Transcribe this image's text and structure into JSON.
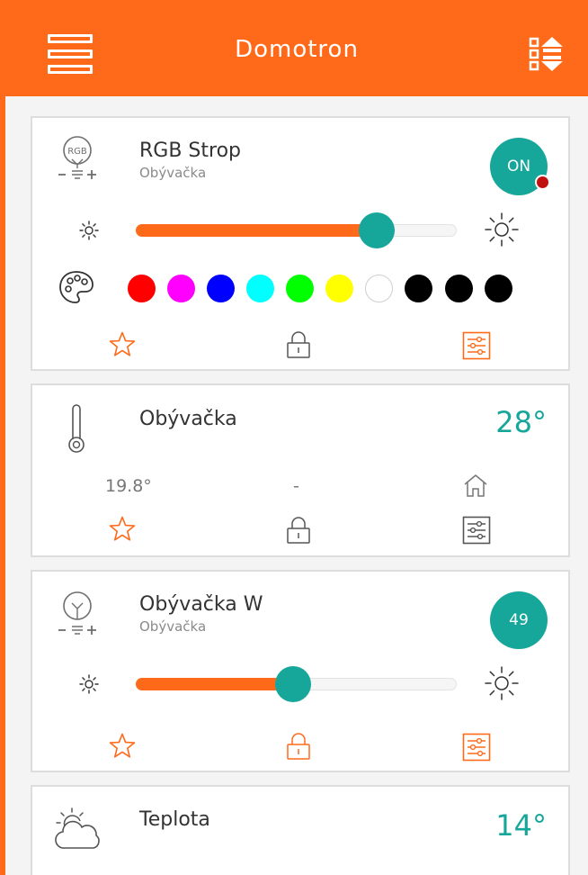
{
  "header": {
    "title": "Domotron",
    "menu_icon": "menu-icon",
    "sort_icon": "sort-icon"
  },
  "colors": {
    "accent": "#ff6a1a",
    "teal": "#17a79a",
    "badge_dot": "#c01010"
  },
  "cards": {
    "rgb": {
      "title": "RGB Strop",
      "room": "Obývačka",
      "icon_text": "RGB",
      "state": "ON",
      "brightness_percent": 75,
      "colors": [
        "#ff0000",
        "#ff00ff",
        "#0000ff",
        "#00ffff",
        "#00ff00",
        "#ffff00",
        "#ffffff",
        "#000000",
        "#000000",
        "#000000"
      ]
    },
    "thermo": {
      "title": "Obývačka",
      "temperature": "28°",
      "setpoint": "19.8°",
      "mode": "-"
    },
    "dimmer": {
      "title": "Obývačka W",
      "room": "Obývačka",
      "level": "49",
      "brightness_percent": 49
    },
    "weather": {
      "title": "Teplota",
      "temperature": "14°"
    }
  }
}
